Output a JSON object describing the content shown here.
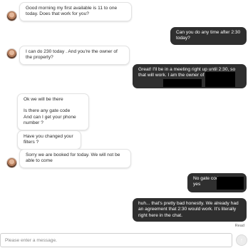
{
  "messages": [
    {
      "direction": "incoming",
      "lines": [
        "Good morning my first available is 11 to one today. Does that work for you?"
      ]
    },
    {
      "direction": "outgoing",
      "lines": [
        "Can you do any time after 2:30 today?"
      ]
    },
    {
      "direction": "incoming",
      "lines": [
        "I can do 230 today . And you're the owner of the property?"
      ]
    },
    {
      "direction": "outgoing",
      "lines": [
        "Great! I'll be in a meeting right up until 2:30, so that will work. I am the owner of the property."
      ]
    },
    {
      "direction": "incoming",
      "lines": [
        "Ok we will be there",
        "Is there any gate code",
        "And can I get your phone number ?"
      ]
    },
    {
      "direction": "incoming",
      "lines": [
        "Have you changed your filters ?"
      ]
    },
    {
      "direction": "incoming",
      "lines": [
        "Sorry we are booked for today. We will not be able to come"
      ]
    },
    {
      "direction": "outgoing",
      "lines": [
        "No gate code.",
        "yes"
      ]
    },
    {
      "direction": "outgoing",
      "lines": [
        "huh... that's pretty bad honestly. We already had an agreement that 2:30 would work. It's literally right here in the chat."
      ]
    }
  ],
  "read_receipt": "Read",
  "composer": {
    "placeholder": "Please enter a message."
  },
  "send_icon": "arrow-up-icon",
  "colors": {
    "outgoing_bubble": "#2f2f2f",
    "incoming_bubble": "#ffffff",
    "send_button": "#ececec"
  }
}
